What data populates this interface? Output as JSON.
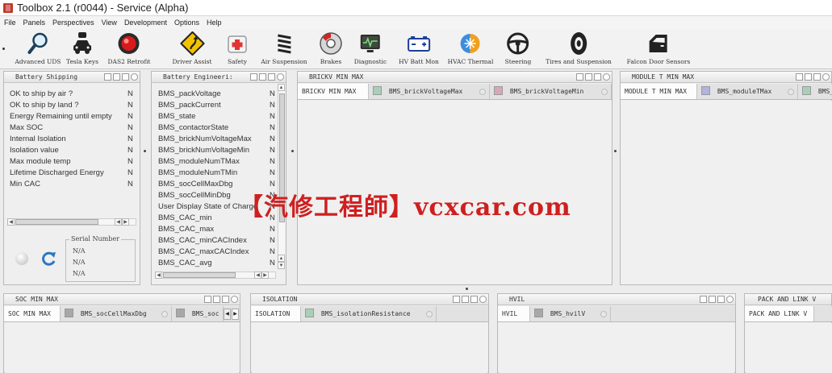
{
  "window": {
    "title": "Toolbox 2.1 (r0044) - Service (Alpha)"
  },
  "menu": [
    "File",
    "Panels",
    "Perspectives",
    "View",
    "Development",
    "Options",
    "Help"
  ],
  "toolbar": [
    {
      "label": "Advanced UDS",
      "icon": "magnifier-icon"
    },
    {
      "label": "Tesla Keys",
      "icon": "car-key-icon"
    },
    {
      "label": "DAS2 Retrofit",
      "icon": "red-light-icon"
    },
    {
      "label": "Driver Assist",
      "icon": "road-sign-icon"
    },
    {
      "label": "Safety",
      "icon": "first-aid-icon"
    },
    {
      "label": "Air Suspension",
      "icon": "spring-icon"
    },
    {
      "label": "Brakes",
      "icon": "brake-disc-icon"
    },
    {
      "label": "Diagnostic",
      "icon": "monitor-icon"
    },
    {
      "label": "HV Batt Mon",
      "icon": "battery-icon"
    },
    {
      "label": "HVAC Thermal",
      "icon": "snow-sun-icon"
    },
    {
      "label": "Steering",
      "icon": "steering-wheel-icon"
    },
    {
      "label": "Tires and Suspension",
      "icon": "tire-icon"
    },
    {
      "label": "Falcon Door Sensors",
      "icon": "door-icon"
    }
  ],
  "battery_shipping": {
    "title": "Battery Shipping",
    "rows": [
      {
        "label": "OK to ship by air ?",
        "value": "N"
      },
      {
        "label": "OK to ship by land ?",
        "value": "N"
      },
      {
        "label": "Energy Remaining until empty",
        "value": "N"
      },
      {
        "label": "Max SOC",
        "value": "N"
      },
      {
        "label": "Internal Isolation",
        "value": "N"
      },
      {
        "label": "Isolation value",
        "value": "N"
      },
      {
        "label": "Max module temp",
        "value": "N"
      },
      {
        "label": "Lifetime Discharged Energy",
        "value": "N"
      },
      {
        "label": "Min CAC",
        "value": "N"
      }
    ],
    "serial_legend": "Serial Number",
    "serial_values": [
      "N/A",
      "N/A",
      "N/A"
    ]
  },
  "battery_engineering": {
    "title": "Battery Engineeri:",
    "rows": [
      {
        "label": "BMS_packVoltage",
        "value": "N"
      },
      {
        "label": "BMS_packCurrent",
        "value": "N"
      },
      {
        "label": "BMS_state",
        "value": "N"
      },
      {
        "label": "BMS_contactorState",
        "value": "N"
      },
      {
        "label": "BMS_brickNumVoltageMax",
        "value": "N"
      },
      {
        "label": "BMS_brickNumVoltageMin",
        "value": "N"
      },
      {
        "label": "BMS_moduleNumTMax",
        "value": "N"
      },
      {
        "label": "BMS_moduleNumTMin",
        "value": "N"
      },
      {
        "label": "BMS_socCellMaxDbg",
        "value": "N"
      },
      {
        "label": "BMS_socCellMinDbg",
        "value": "N"
      },
      {
        "label": "User Display State of Charge",
        "value": "N"
      },
      {
        "label": "BMS_CAC_min",
        "value": "N"
      },
      {
        "label": "BMS_CAC_max",
        "value": "N"
      },
      {
        "label": "BMS_CAC_minCACIndex",
        "value": "N"
      },
      {
        "label": "BMS_CAC_maxCACIndex",
        "value": "N"
      },
      {
        "label": "BMS_CAC_avg",
        "value": "N"
      }
    ]
  },
  "brickv": {
    "title": "BRICKV MIN MAX",
    "tabs": [
      {
        "label": "BRICKV MIN MAX"
      },
      {
        "label": "BMS_brickVoltageMax",
        "color": "#a8d0b8"
      },
      {
        "label": "BMS_brickVoltageMin",
        "color": "#d8a8b4"
      }
    ]
  },
  "module_t": {
    "title": "MODULE T MIN MAX",
    "tabs": [
      {
        "label": "MODULE T MIN MAX"
      },
      {
        "label": "BMS_moduleTMax",
        "color": "#b0b4e0"
      },
      {
        "label": "BMS_",
        "color": "#a8d0b8"
      }
    ]
  },
  "soc": {
    "title": "SOC MIN MAX",
    "tabs": [
      {
        "label": "SOC MIN MAX"
      },
      {
        "label": "BMS_socCellMaxDbg",
        "color": "#a8a8a8"
      },
      {
        "label": "BMS_soc",
        "color": "#a8a8a8"
      }
    ]
  },
  "isolation": {
    "title": "ISOLATION",
    "tabs": [
      {
        "label": "ISOLATION"
      },
      {
        "label": "BMS_isolationResistance",
        "color": "#a8d0b8"
      }
    ]
  },
  "hvil": {
    "title": "HVIL",
    "tabs": [
      {
        "label": "HVIL"
      },
      {
        "label": "BMS_hvilV",
        "color": "#a8a8a8"
      }
    ]
  },
  "pack_link": {
    "title": "PACK AND LINK V",
    "tabs": [
      {
        "label": "PACK AND LINK V"
      }
    ]
  },
  "watermark": "【汽修工程師】vcxcar.com"
}
